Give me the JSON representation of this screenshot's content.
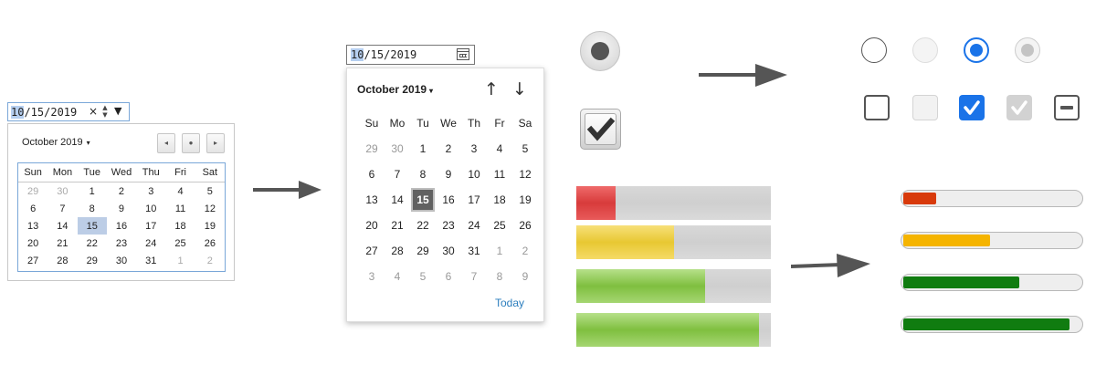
{
  "old_date_input": {
    "value_month": "10",
    "value_rest": "/15/2019",
    "clear_glyph": "×",
    "spin_up": "▲",
    "spin_down": "▼",
    "dropdown_glyph": "▼"
  },
  "old_calendar": {
    "month_label": "October 2019",
    "caret": "▾",
    "prev_glyph": "◂",
    "today_glyph": "●",
    "next_glyph": "▸",
    "weekdays": [
      "Sun",
      "Mon",
      "Tue",
      "Wed",
      "Thu",
      "Fri",
      "Sat"
    ],
    "weeks": [
      [
        "29",
        "30",
        "1",
        "2",
        "3",
        "4",
        "5"
      ],
      [
        "6",
        "7",
        "8",
        "9",
        "10",
        "11",
        "12"
      ],
      [
        "13",
        "14",
        "15",
        "16",
        "17",
        "18",
        "19"
      ],
      [
        "20",
        "21",
        "22",
        "23",
        "24",
        "25",
        "26"
      ],
      [
        "27",
        "28",
        "29",
        "30",
        "31",
        "1",
        "2"
      ]
    ]
  },
  "new_date_input": {
    "value_month": "10",
    "value_rest": "/15/2019",
    "icon": "calendar-icon"
  },
  "new_calendar": {
    "month_label": "October 2019",
    "caret": "▾",
    "up_glyph": "↑",
    "down_glyph": "↓",
    "weekdays": [
      "Su",
      "Mo",
      "Tu",
      "We",
      "Th",
      "Fr",
      "Sa"
    ],
    "weeks": [
      [
        "29",
        "30",
        "1",
        "2",
        "3",
        "4",
        "5"
      ],
      [
        "6",
        "7",
        "8",
        "9",
        "10",
        "11",
        "12"
      ],
      [
        "13",
        "14",
        "15",
        "16",
        "17",
        "18",
        "19"
      ],
      [
        "20",
        "21",
        "22",
        "23",
        "24",
        "25",
        "26"
      ],
      [
        "27",
        "28",
        "29",
        "30",
        "31",
        "1",
        "2"
      ],
      [
        "3",
        "4",
        "5",
        "6",
        "7",
        "8",
        "9"
      ]
    ],
    "today_label": "Today"
  },
  "colors": {
    "accent_blue": "#1a73e8",
    "meter_red": "#d83a0b",
    "meter_yellow": "#f5b400",
    "meter_green": "#107c10"
  },
  "meters": {
    "levels": [
      0.2,
      0.5,
      0.66,
      0.94
    ]
  }
}
